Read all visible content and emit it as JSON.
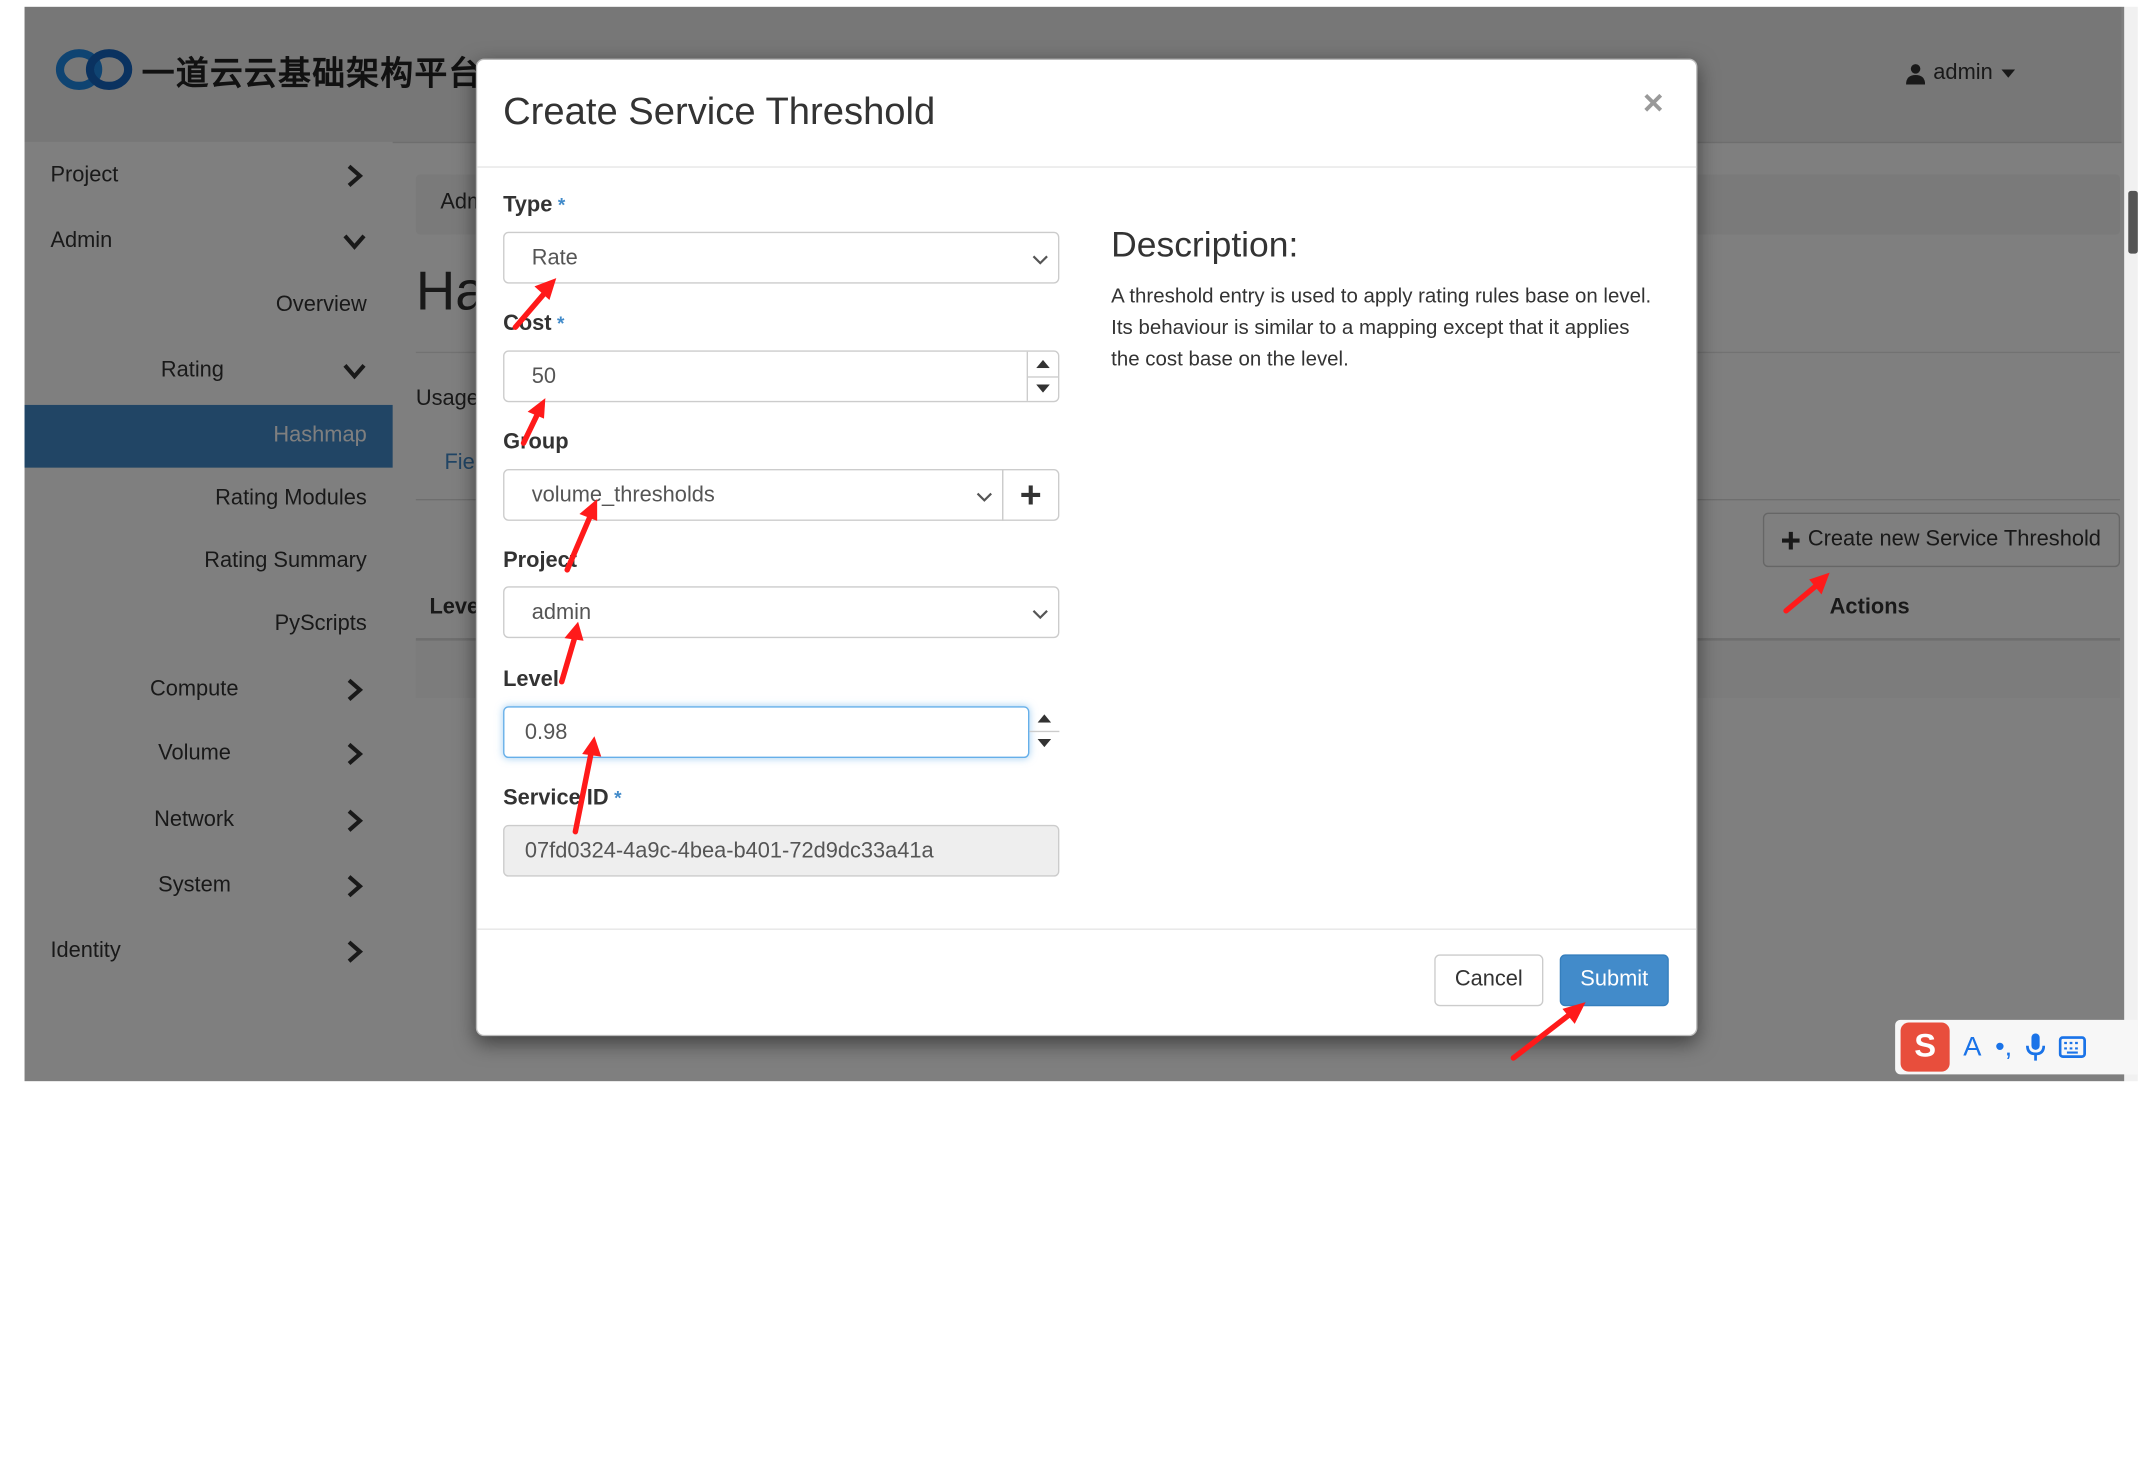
{
  "header": {
    "logo_text": "一道云云基础架构平台",
    "user": "admin"
  },
  "sidebar": {
    "items": [
      {
        "label": "Project"
      },
      {
        "label": "Admin"
      },
      {
        "label": "Overview"
      },
      {
        "label": "Rating"
      },
      {
        "label": "Hashmap"
      },
      {
        "label": "Rating Modules"
      },
      {
        "label": "Rating Summary"
      },
      {
        "label": "PyScripts"
      },
      {
        "label": "Compute"
      },
      {
        "label": "Volume"
      },
      {
        "label": "Network"
      },
      {
        "label": "System"
      },
      {
        "label": "Identity"
      }
    ]
  },
  "content": {
    "breadcrumb": "Adm",
    "page_title": "Ha",
    "usage_text": "Usage",
    "tab_label": "Fiel",
    "create_button": "Create new Service Threshold",
    "table_headers": {
      "level": "Leve",
      "actions": "Actions"
    }
  },
  "modal": {
    "title": "Create Service Threshold",
    "close": "×",
    "fields": {
      "type": {
        "label": "Type",
        "required": "*",
        "value": "Rate"
      },
      "cost": {
        "label": "Cost",
        "required": "*",
        "value": "50"
      },
      "group": {
        "label": "Group",
        "value": "volume_thresholds"
      },
      "project": {
        "label": "Project",
        "value": "admin"
      },
      "level": {
        "label": "Level",
        "value": "0.98"
      },
      "service_id": {
        "label": "Service ID",
        "required": "*",
        "value": "07fd0324-4a9c-4bea-b401-72d9dc33a41a"
      }
    },
    "description": {
      "title": "Description:",
      "body": "A threshold entry is used to apply rating rules base on level. Its behaviour is similar to a mapping except that it applies the cost base on the level."
    },
    "buttons": {
      "cancel": "Cancel",
      "submit": "Submit"
    }
  },
  "ime": {
    "glyphs": [
      "A",
      "•,",
      "mic",
      "kbd"
    ]
  },
  "colors": {
    "primary": "#428bca",
    "annotation_arrow": "#ff1a1a",
    "ime_brand": "#e84e3c"
  }
}
